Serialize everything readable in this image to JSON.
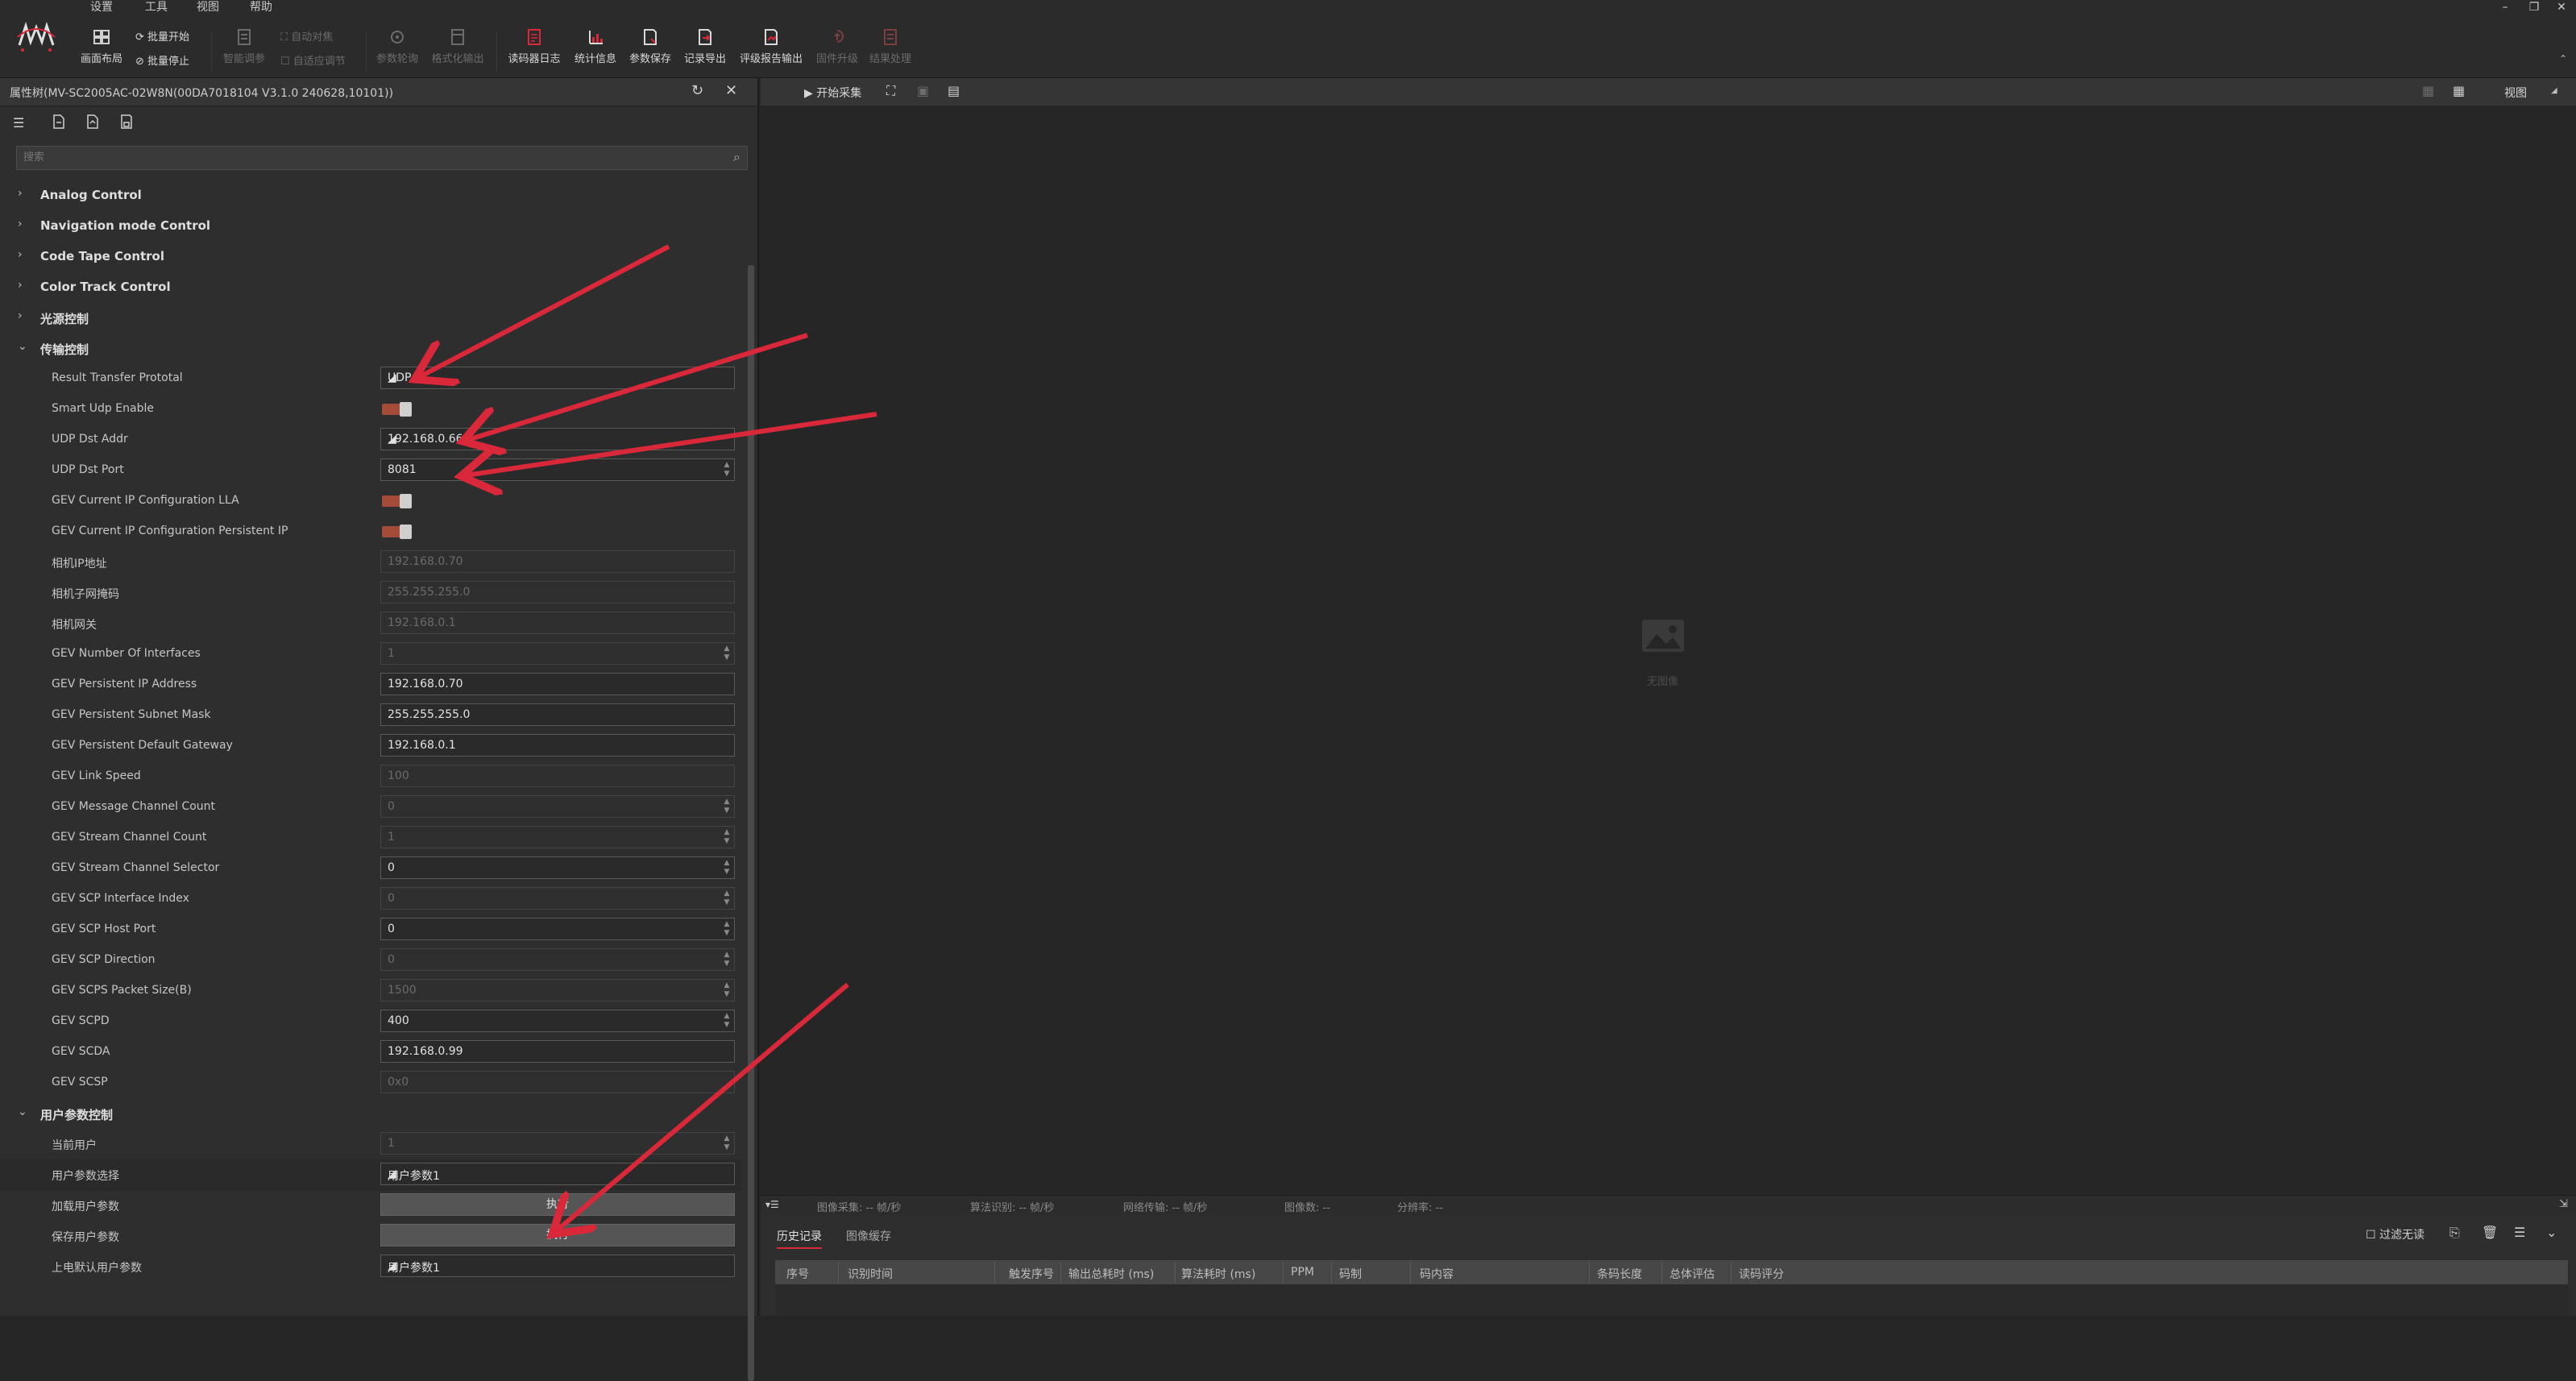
{
  "menu": {
    "items": [
      "设置",
      "工具",
      "视图",
      "帮助"
    ]
  },
  "toolbar": {
    "layout_label": "画面布局",
    "batch_start_label": "批量开始",
    "batch_stop_label": "批量停止",
    "smart_tune_label": "智能调参",
    "auto_focus_label": "自动对焦",
    "auto_adjust_label": "自适应调节",
    "param_poll_label": "参数轮询",
    "format_output_label": "格式化输出",
    "reader_log_label": "读码器日志",
    "stats_label": "统计信息",
    "param_save_label": "参数保存",
    "record_export_label": "记录导出",
    "grade_report_label": "评级报告输出",
    "firmware_upgrade_label": "固件升级",
    "result_process_label": "结果处理"
  },
  "window_controls": {
    "minimize": "–",
    "restore": "❐",
    "close": "✕"
  },
  "props_panel": {
    "title": "属性树(MV-SC2005AC-02W8N(00DA7018104 V3.1.0 240628,10101))",
    "search_placeholder": "搜索",
    "groups": {
      "analog": "Analog Control",
      "navigation": "Navigation mode Control",
      "code_tape": "Code Tape Control",
      "color_track": "Color Track Control",
      "light": "光源控制",
      "transfer": "传输控制",
      "user_param": "用户参数控制"
    },
    "params": {
      "result_transfer_protocol": {
        "label": "Result Transfer Prototal",
        "value": "UDP"
      },
      "smart_udp_enable": {
        "label": "Smart Udp Enable"
      },
      "udp_dst_addr": {
        "label": "UDP Dst Addr",
        "value": "192.168.0.66"
      },
      "udp_dst_port": {
        "label": "UDP Dst Port",
        "value": "8081"
      },
      "gev_ip_lla": {
        "label": "GEV Current IP Configuration LLA"
      },
      "gev_ip_persistent": {
        "label": "GEV Current IP Configuration Persistent IP"
      },
      "camera_ip": {
        "label": "相机IP地址",
        "value": "192.168.0.70"
      },
      "camera_mask": {
        "label": "相机子网掩码",
        "value": "255.255.255.0"
      },
      "camera_gateway": {
        "label": "相机网关",
        "value": "192.168.0.1"
      },
      "gev_num_interfaces": {
        "label": "GEV Number Of Interfaces",
        "value": "1"
      },
      "gev_persistent_ip": {
        "label": "GEV Persistent IP Address",
        "value": "192.168.0.70"
      },
      "gev_persistent_mask": {
        "label": "GEV Persistent Subnet Mask",
        "value": "255.255.255.0"
      },
      "gev_persistent_gateway": {
        "label": "GEV Persistent Default Gateway",
        "value": "192.168.0.1"
      },
      "gev_link_speed": {
        "label": "GEV Link Speed",
        "value": "100"
      },
      "gev_msg_channel_count": {
        "label": "GEV Message Channel Count",
        "value": "0"
      },
      "gev_stream_channel_count": {
        "label": "GEV Stream Channel Count",
        "value": "1"
      },
      "gev_stream_channel_selector": {
        "label": "GEV Stream Channel Selector",
        "value": "0"
      },
      "gev_scp_interface_index": {
        "label": "GEV SCP Interface Index",
        "value": "0"
      },
      "gev_scp_host_port": {
        "label": "GEV SCP Host Port",
        "value": "0"
      },
      "gev_scp_direction": {
        "label": "GEV SCP Direction",
        "value": "0"
      },
      "gev_scps_packet_size": {
        "label": "GEV SCPS Packet Size(B)",
        "value": "1500"
      },
      "gev_scpd": {
        "label": "GEV SCPD",
        "value": "400"
      },
      "gev_scda": {
        "label": "GEV SCDA",
        "value": "192.168.0.99"
      },
      "gev_scsp": {
        "label": "GEV SCSP",
        "value": "0x0"
      },
      "current_user": {
        "label": "当前用户",
        "value": "1"
      },
      "user_param_select": {
        "label": "用户参数选择",
        "value": "用户参数1"
      },
      "load_user_param": {
        "label": "加载用户参数",
        "value": "执行"
      },
      "save_user_param": {
        "label": "保存用户参数",
        "value": "执行"
      },
      "power_on_default": {
        "label": "上电默认用户参数",
        "value": "用户参数1"
      }
    }
  },
  "view": {
    "start_capture_label": "开始采集",
    "view_label": "视图",
    "no_image_label": "无图像"
  },
  "status": {
    "image_capture": "图像采集: -- 帧/秒",
    "algo_recognition": "算法识别: -- 帧/秒",
    "network_transfer": "网络传输: -- 帧/秒",
    "image_count": "图像数: --",
    "resolution": "分辨率: --"
  },
  "history": {
    "tab_history": "历史记录",
    "tab_image_cache": "图像缓存",
    "filter_no_read_label": "过滤无读",
    "columns": [
      "序号",
      "识别时间",
      "触发序号",
      "输出总耗时 (ms)",
      "算法耗时 (ms)",
      "PPM",
      "码制",
      "码内容",
      "条码长度",
      "总体评估",
      "读码评分"
    ]
  },
  "colors": {
    "accent_red": "#d9283a",
    "toggle_track": "#a44b3a",
    "background": "#262626",
    "panel": "#2e2e2e"
  }
}
